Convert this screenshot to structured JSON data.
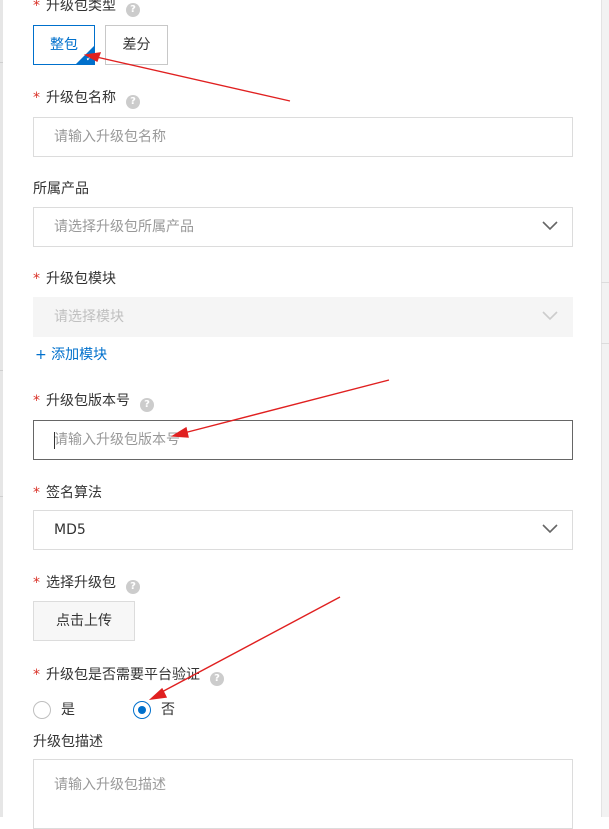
{
  "form": {
    "package_type": {
      "label": "升级包类型",
      "required_mark": "*",
      "options": [
        "整包",
        "差分"
      ],
      "selected": "整包"
    },
    "package_name": {
      "label": "升级包名称",
      "required_mark": "*",
      "placeholder": "请输入升级包名称"
    },
    "product": {
      "label": "所属产品",
      "placeholder": "请选择升级包所属产品"
    },
    "module": {
      "label": "升级包模块",
      "required_mark": "*",
      "placeholder": "请选择模块",
      "add_link": "+ 添加模块"
    },
    "version": {
      "label": "升级包版本号",
      "required_mark": "*",
      "placeholder": "请输入升级包版本号"
    },
    "signature": {
      "label": "签名算法",
      "required_mark": "*",
      "value": "MD5"
    },
    "upload": {
      "label": "选择升级包",
      "required_mark": "*",
      "button": "点击上传"
    },
    "verify": {
      "label": "升级包是否需要平台验证",
      "required_mark": "*",
      "options": [
        "是",
        "否"
      ],
      "selected": "否"
    },
    "description": {
      "label": "升级包描述",
      "placeholder": "请输入升级包描述"
    }
  },
  "icons": {
    "help": "help-circle-icon",
    "chevron": "chevron-down-icon",
    "selected_corner": "check-corner-icon"
  },
  "colors": {
    "primary": "#0070cc",
    "required": "#d93026",
    "annotation_arrow": "#e02020"
  }
}
